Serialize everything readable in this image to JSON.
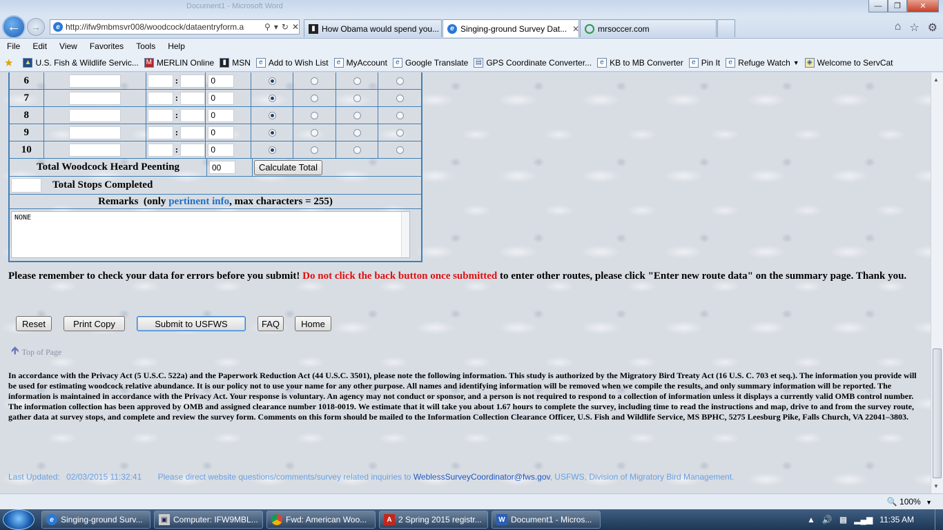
{
  "browser": {
    "window_title": "Document1 - Microsoft Word",
    "address_url": "http://ifw9mbmsvr008/woodcock/dataentryform.a",
    "tabs": [
      {
        "label": "How Obama would spend you...",
        "active": false
      },
      {
        "label": "Singing-ground Survey Dat...",
        "active": true
      },
      {
        "label": "mrsoccer.com",
        "active": false
      }
    ],
    "menu": [
      "File",
      "Edit",
      "View",
      "Favorites",
      "Tools",
      "Help"
    ],
    "favorites": [
      "U.S. Fish & Wildlife Servic...",
      "MERLIN Online",
      "MSN",
      "Add to Wish List",
      "MyAccount",
      "Google Translate",
      "GPS Coordinate Converter...",
      "KB to MB Converter",
      "Pin It",
      "Refuge Watch",
      "Welcome to ServCat"
    ],
    "zoom": "100%"
  },
  "form": {
    "stops": [
      {
        "num": "6",
        "count": "0",
        "selected": 0
      },
      {
        "num": "7",
        "count": "0",
        "selected": 0
      },
      {
        "num": "8",
        "count": "0",
        "selected": 0
      },
      {
        "num": "9",
        "count": "0",
        "selected": 0
      },
      {
        "num": "10",
        "count": "0",
        "selected": 0
      }
    ],
    "time_separator": ":",
    "total_label": "Total Woodcock Heard Peenting",
    "total_value": "00",
    "calculate_label": "Calculate Total",
    "stops_completed_label": "Total Stops Completed",
    "remarks_prefix": "Remarks  (only ",
    "remarks_link": "pertinent info",
    "remarks_suffix": ", max characters = 255)",
    "remarks_value": "NONE"
  },
  "reminder": {
    "part1": "Please remember to check your data for errors before you submit! ",
    "warning": "Do not click the back button once submitted",
    "part2": " to enter other routes, please click \"Enter new route data\" on the summary page. Thank you."
  },
  "actions": {
    "reset": "Reset",
    "print": "Print Copy",
    "submit": "Submit to USFWS",
    "faq": "FAQ",
    "home": "Home"
  },
  "top_of_page": "Top of Page",
  "privacy_text": "In accordance with the Privacy Act (5 U.S.C. 522a) and the Paperwork Reduction Act (44 U.S.C. 3501), please note the following information. This study is authorized by the Migratory Bird Treaty Act (16 U.S. C. 703 et seq.). The information you provide will be used for estimating woodcock relative abundance. It is our policy not to use your name for any other purpose. All names and identifying information will be removed when we compile the results, and only summary information will be reported. The information is maintained in accordance with the Privacy Act. Your response is voluntary. An agency may not conduct or sponsor, and a person is not required to respond to a collection of information unless it displays a currently valid OMB control number. The information collection has been approved by OMB and assigned clearance number 1018-0019. We estimate that it will take you about 1.67 hours to complete the survey, including time to read the instructions and map, drive to and from the survey route, gather data at survey stops, and complete and review the survey form. Comments on this form should be mailed to the Information Collection Clearance Officer, U.S. Fish and Wildlife Service, MS BPHC, 5275 Leesburg Pike, Falls Church, VA 22041–3803.",
  "footer": {
    "last_updated_label": "Last Updated:",
    "last_updated_value": "02/03/2015 11:32:41",
    "direct_text": "Please direct website questions/comments/survey related inquiries to",
    "email": "WeblessSurveyCoordinator@fws.gov",
    "org": ", USFWS, Division of Migratory Bird Management."
  },
  "taskbar": {
    "items": [
      "Singing-ground Surv...",
      "Computer: IFW9MBL...",
      "Fwd: American Woo...",
      "2 Spring 2015 registr...",
      "Document1 - Micros..."
    ],
    "time": "11:35 AM"
  }
}
